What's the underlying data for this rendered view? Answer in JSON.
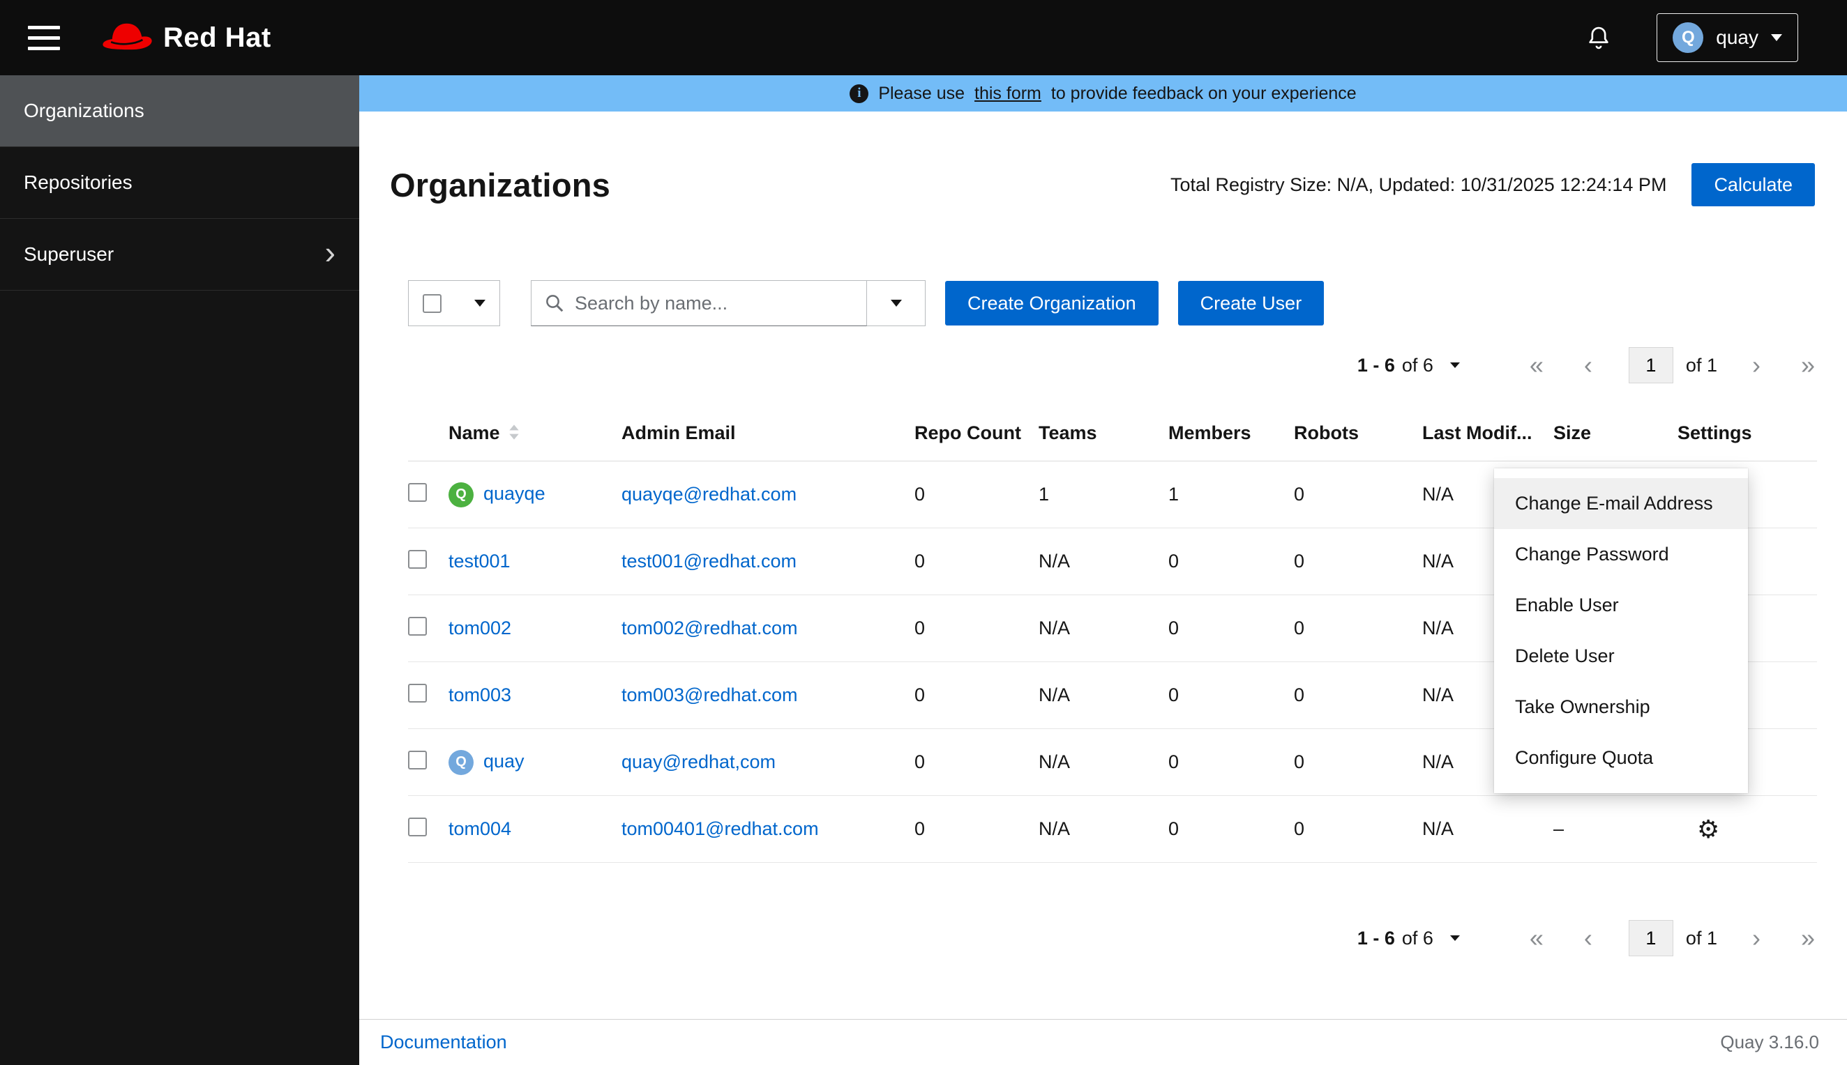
{
  "colors": {
    "primary": "#0066cc",
    "banner": "#73bcf7",
    "masthead": "#0d0d0d",
    "nav_selected": "#4f5255",
    "link": "#0066cc"
  },
  "icons": {
    "gear": "⚙",
    "first_page": "«",
    "prev_page": "‹",
    "next_page": "›",
    "last_page": "»",
    "chevron_right": "›"
  },
  "header": {
    "brand": "Red Hat",
    "user": {
      "name": "quay",
      "avatar_letter": "Q",
      "avatar_color": "#73a8dd"
    }
  },
  "sidebar": {
    "items": [
      {
        "label": "Organizations",
        "selected": true,
        "expandable": false
      },
      {
        "label": "Repositories",
        "selected": false,
        "expandable": false
      },
      {
        "label": "Superuser",
        "selected": false,
        "expandable": true
      }
    ]
  },
  "banner": {
    "text_before": "Please use",
    "link_text": "this form",
    "text_after": "to provide feedback on your experience"
  },
  "page": {
    "title": "Organizations",
    "registry_size_text": "Total Registry Size: N/A, Updated: 10/31/2025 12:24:14 PM",
    "calculate_label": "Calculate"
  },
  "toolbar": {
    "search_placeholder": "Search by name...",
    "create_org_label": "Create Organization",
    "create_user_label": "Create User"
  },
  "pagination": {
    "range_bold": "1 - 6",
    "range_suffix": "of 6",
    "page": "1",
    "of_label": "of 1"
  },
  "table": {
    "columns": [
      "Name",
      "Admin Email",
      "Repo Count",
      "Teams",
      "Members",
      "Robots",
      "Last Modif...",
      "Size",
      "Settings"
    ],
    "rows": [
      {
        "name": "quayqe",
        "avatar": "Q",
        "avatar_color": "#4CB140",
        "email": "quayqe@redhat.com",
        "repo_count": "0",
        "teams": "1",
        "members": "1",
        "robots": "0",
        "last_modified": "N/A",
        "size": ""
      },
      {
        "name": "test001",
        "avatar": "",
        "avatar_color": "",
        "email": "test001@redhat.com",
        "repo_count": "0",
        "teams": "N/A",
        "members": "0",
        "robots": "0",
        "last_modified": "N/A",
        "size": ""
      },
      {
        "name": "tom002",
        "avatar": "",
        "avatar_color": "",
        "email": "tom002@redhat.com",
        "repo_count": "0",
        "teams": "N/A",
        "members": "0",
        "robots": "0",
        "last_modified": "N/A",
        "size": ""
      },
      {
        "name": "tom003",
        "avatar": "",
        "avatar_color": "",
        "email": "tom003@redhat.com",
        "repo_count": "0",
        "teams": "N/A",
        "members": "0",
        "robots": "0",
        "last_modified": "N/A",
        "size": ""
      },
      {
        "name": "quay",
        "avatar": "Q",
        "avatar_color": "#73a8dd",
        "email": "quay@redhat,com",
        "repo_count": "0",
        "teams": "N/A",
        "members": "0",
        "robots": "0",
        "last_modified": "N/A",
        "size": ""
      },
      {
        "name": "tom004",
        "avatar": "",
        "avatar_color": "",
        "email": "tom00401@redhat.com",
        "repo_count": "0",
        "teams": "N/A",
        "members": "0",
        "robots": "0",
        "last_modified": "N/A",
        "size": "–"
      }
    ]
  },
  "context_menu": {
    "items": [
      "Change E-mail Address",
      "Change Password",
      "Enable User",
      "Delete User",
      "Take Ownership",
      "Configure Quota"
    ],
    "highlighted_index": 0
  },
  "footer": {
    "doc_link": "Documentation",
    "version": "Quay 3.16.0"
  }
}
